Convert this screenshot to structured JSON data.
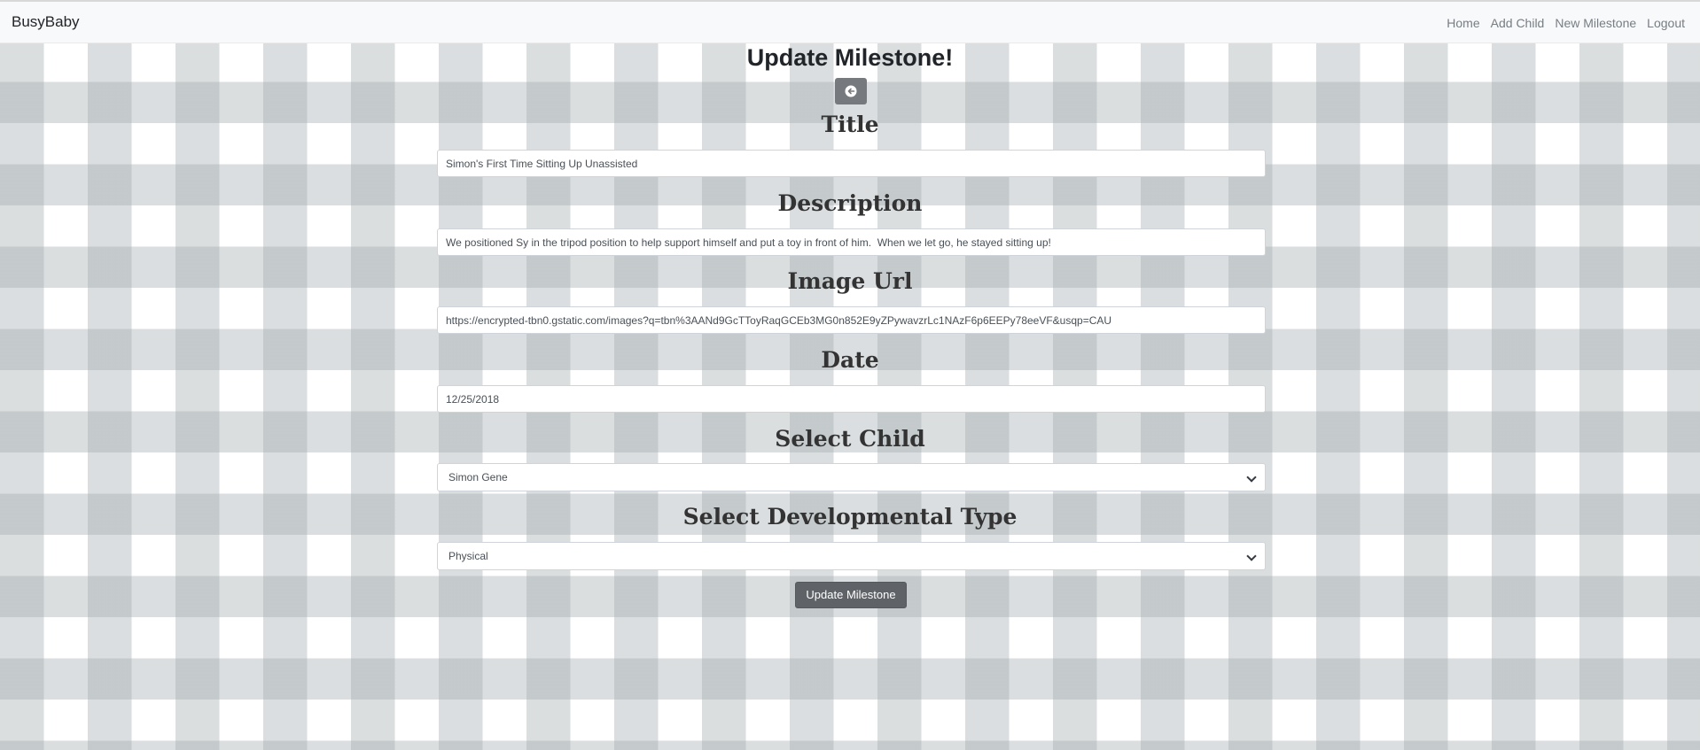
{
  "navbar": {
    "brand": "BusyBaby",
    "links": [
      "Home",
      "Add Child",
      "New Milestone",
      "Logout"
    ]
  },
  "page": {
    "title": "Update Milestone!",
    "back_icon": "back-arrow-icon"
  },
  "form": {
    "title_label": "Title",
    "title_value": "Simon's First Time Sitting Up Unassisted",
    "description_label": "Description",
    "description_value": "We positioned Sy in the tripod position to help support himself and put a toy in front of him.  When we let go, he stayed sitting up!",
    "image_label": "Image Url",
    "image_value": "https://encrypted-tbn0.gstatic.com/images?q=tbn%3AANd9GcTToyRaqGCEb3MG0n852E9yZPywavzrLc1NAzF6p6EEPy78eeVF&usqp=CAU",
    "date_label": "Date",
    "date_value": "12/25/2018",
    "child_label": "Select Child",
    "child_value": "Simon Gene",
    "type_label": "Select Developmental Type",
    "type_value": "Physical",
    "submit_label": "Update Milestone"
  },
  "colors": {
    "navbar_bg": "#f8f9fa",
    "button_bg": "#5f6367",
    "gingham": "#a0a8ac"
  }
}
